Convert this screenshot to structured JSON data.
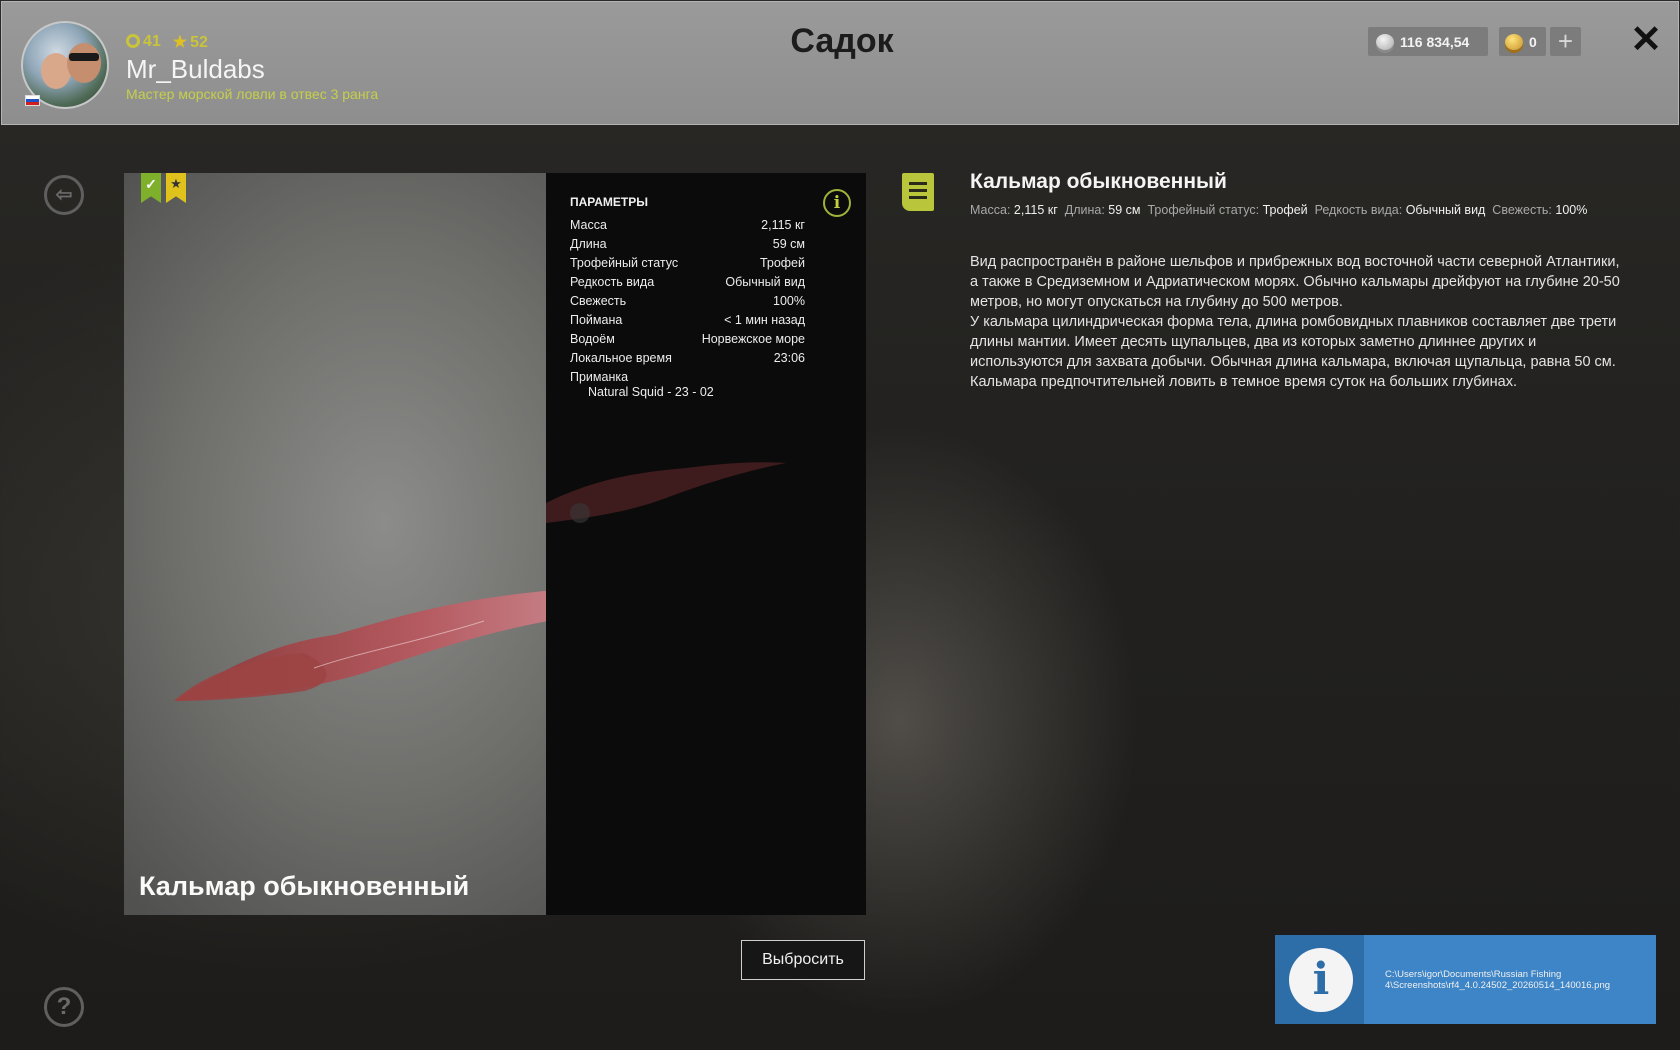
{
  "header": {
    "title": "Садок",
    "username": "Mr_Buldabs",
    "user_title": "Мастер морской ловли в отвес 3 ранга",
    "rank": "41",
    "stars": "52",
    "silver": "116 834,54",
    "gold": "0",
    "plus_icon": "plus-icon",
    "close_icon": "close-icon"
  },
  "fish": {
    "name": "Кальмар обыкновенный",
    "params_heading": "ПАРАМЕТРЫ",
    "params": [
      {
        "label": "Масса",
        "value": "2,115 кг"
      },
      {
        "label": "Длина",
        "value": "59 см"
      },
      {
        "label": "Трофейный статус",
        "value": "Трофей"
      },
      {
        "label": "Редкость вида",
        "value": "Обычный вид"
      },
      {
        "label": "Свежесть",
        "value": "100%"
      },
      {
        "label": "Поймана",
        "value": "< 1 мин назад"
      },
      {
        "label": "Водоём",
        "value": "Норвежское море"
      },
      {
        "label": "Локальное время",
        "value": "23:06"
      }
    ],
    "bait_label": "Приманка",
    "bait_value": "Natural Squid - 23 - 02",
    "discard_label": "Выбросить"
  },
  "description": {
    "title": "Кальмар обыкновенный",
    "meta": [
      {
        "label": "Масса:",
        "value": "2,115 кг"
      },
      {
        "label": "Длина:",
        "value": "59 см"
      },
      {
        "label": "Трофейный статус:",
        "value": "Трофей"
      },
      {
        "label": "Редкость вида:",
        "value": "Обычный вид"
      },
      {
        "label": "Свежесть:",
        "value": "100%"
      }
    ],
    "paragraphs": [
      "Вид распространён в районе шельфов и прибрежных вод восточной части северной Атлантики, а также в Средиземном и Адриатическом морях. Обычно кальмары дрейфуют на глубине 20-50 метров, но могут опускаться на глубину до 500 метров.",
      "У кальмара цилиндрическая форма тела, длина ромбовидных плавников составляет две трети длины мантии. Имеет десять щупальцев, два из которых заметно длиннее других и используются для захвата добычи. Обычная длина кальмара, включая щупальца, равна 50 см.",
      "Кальмара предпочтительней ловить в темное время суток на больших глубинах."
    ]
  },
  "toast": {
    "path": "C:\\Users\\igor\\Documents\\Russian Fishing 4\\Screenshots\\rf4_4.0.24502_20260514_140016.png"
  },
  "colors": {
    "accent_green": "#b9c53a",
    "toast_blue": "#3d85c6"
  }
}
